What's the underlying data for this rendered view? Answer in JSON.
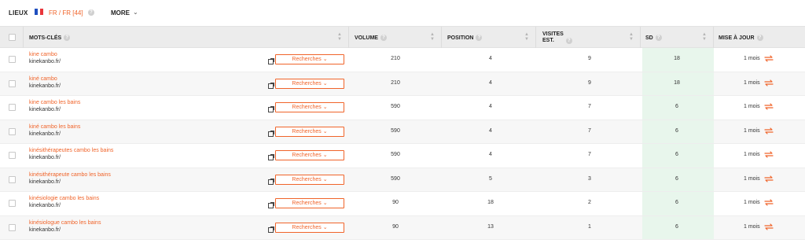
{
  "toolbar": {
    "lieux_label": "LIEUX",
    "flag_colors": [
      "#1f4fbf",
      "#ffffff",
      "#e8353b"
    ],
    "location": "FR / FR",
    "count": "[44]",
    "more_label": "MORE"
  },
  "columns": {
    "keywords": "MOTS-CLÉS",
    "volume": "VOLUME",
    "position": "POSITION",
    "visits_line1": "VISITES",
    "visits_line2": "EST.",
    "sd": "SD",
    "updated": "MISE À JOUR"
  },
  "rows": [
    {
      "keyword": "kine cambo",
      "url": "kinekanbo.fr/",
      "button": "Recherches",
      "volume": "210",
      "position": "4",
      "visits": "9",
      "sd": "18",
      "updated": "1 mois"
    },
    {
      "keyword": "kiné cambo",
      "url": "kinekanbo.fr/",
      "button": "Recherches",
      "volume": "210",
      "position": "4",
      "visits": "9",
      "sd": "18",
      "updated": "1 mois"
    },
    {
      "keyword": "kine cambo les bains",
      "url": "kinekanbo.fr/",
      "button": "Recherches",
      "volume": "590",
      "position": "4",
      "visits": "7",
      "sd": "6",
      "updated": "1 mois"
    },
    {
      "keyword": "kiné cambo les bains",
      "url": "kinekanbo.fr/",
      "button": "Recherches",
      "volume": "590",
      "position": "4",
      "visits": "7",
      "sd": "6",
      "updated": "1 mois"
    },
    {
      "keyword": "kinésithérapeutes cambo les bains",
      "url": "kinekanbo.fr/",
      "button": "Recherches",
      "volume": "590",
      "position": "4",
      "visits": "7",
      "sd": "6",
      "updated": "1 mois"
    },
    {
      "keyword": "kinésithérapeute cambo les bains",
      "url": "kinekanbo.fr/",
      "button": "Recherches",
      "volume": "590",
      "position": "5",
      "visits": "3",
      "sd": "6",
      "updated": "1 mois"
    },
    {
      "keyword": "kinésiologie cambo les bains",
      "url": "kinekanbo.fr/",
      "button": "Recherches",
      "volume": "90",
      "position": "18",
      "visits": "2",
      "sd": "6",
      "updated": "1 mois"
    },
    {
      "keyword": "kinésiologue cambo les bains",
      "url": "kinekanbo.fr/",
      "button": "Recherches",
      "volume": "90",
      "position": "13",
      "visits": "1",
      "sd": "6",
      "updated": "1 mois"
    }
  ],
  "colors": {
    "accent": "#f0642a",
    "sd_highlight": "#e8f6ec",
    "header_bg": "#ececec"
  }
}
